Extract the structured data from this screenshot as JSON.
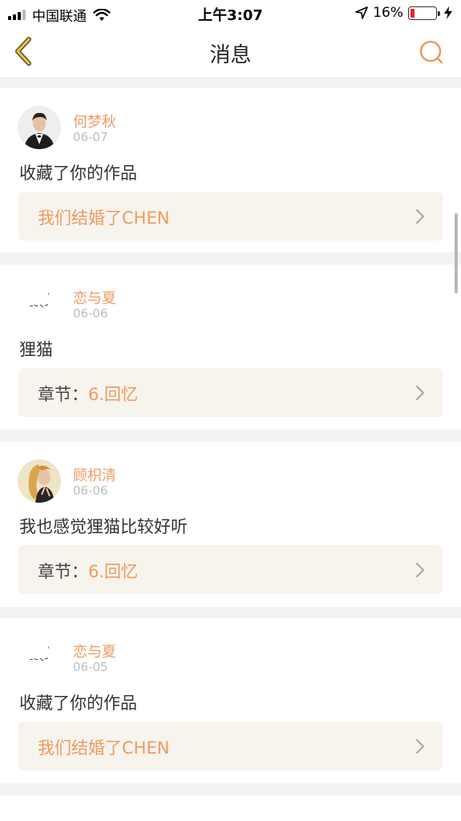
{
  "status_bar": {
    "carrier": "中国联通",
    "time": "上午3:07",
    "battery_percent": "16%",
    "battery_level": 0.16
  },
  "nav": {
    "title": "消息",
    "back_icon": "chevron-left-icon",
    "search_icon": "search-icon"
  },
  "messages": [
    {
      "user": "何梦秋",
      "date": "06-07",
      "text": "收藏了你的作品",
      "link_prefix": "",
      "link_title": "我们结婚了CHEN",
      "avatar": "man-in-tuxedo"
    },
    {
      "user": "恋与夏",
      "date": "06-06",
      "text": "狸猫",
      "link_prefix": "章节：",
      "link_title": "6.回忆",
      "avatar": "calligraphy-logo"
    },
    {
      "user": "顾枳清",
      "date": "06-06",
      "text": "我也感觉狸猫比较好听",
      "link_prefix": "章节：",
      "link_title": "6.回忆",
      "avatar": "blonde-girl"
    },
    {
      "user": "恋与夏",
      "date": "06-05",
      "text": "收藏了你的作品",
      "link_prefix": "",
      "link_title": "我们结婚了CHEN",
      "avatar": "calligraphy-logo"
    }
  ],
  "colors": {
    "accent": "#ee9a63",
    "link_bg": "#f6f4ec",
    "page_bg": "#f4f3f3"
  }
}
